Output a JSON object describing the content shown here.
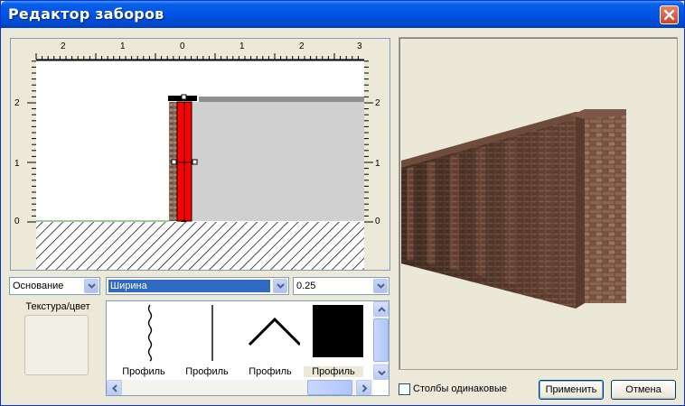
{
  "window": {
    "title": "Редактор заборов"
  },
  "editor": {
    "top_ruler_labels": [
      "2",
      "1",
      "0",
      "1",
      "2",
      "3"
    ],
    "left_ruler_labels": [
      "2",
      "1",
      "0"
    ],
    "right_ruler_labels": [
      "2",
      "1",
      "0"
    ]
  },
  "controls": {
    "base_select": "Основание",
    "param_select": "Ширина",
    "value_select": "0.25",
    "texture_label": "Текстура/цвет"
  },
  "profiles": [
    {
      "label": "Профиль",
      "shape": "wavy-line",
      "selected": false
    },
    {
      "label": "Профиль",
      "shape": "straight-line",
      "selected": false
    },
    {
      "label": "Профиль",
      "shape": "roof-peak",
      "selected": false
    },
    {
      "label": "Профиль",
      "shape": "square-fill",
      "selected": true
    }
  ],
  "footer": {
    "checkbox_label": "Столбы одинаковые",
    "checkbox_checked": false,
    "apply_label": "Применить",
    "cancel_label": "Отмена"
  },
  "colors": {
    "title_bar": "#0054e3",
    "close_button": "#c8452a",
    "selected_post": "#ff0000",
    "brick": "#7a4e3c"
  }
}
